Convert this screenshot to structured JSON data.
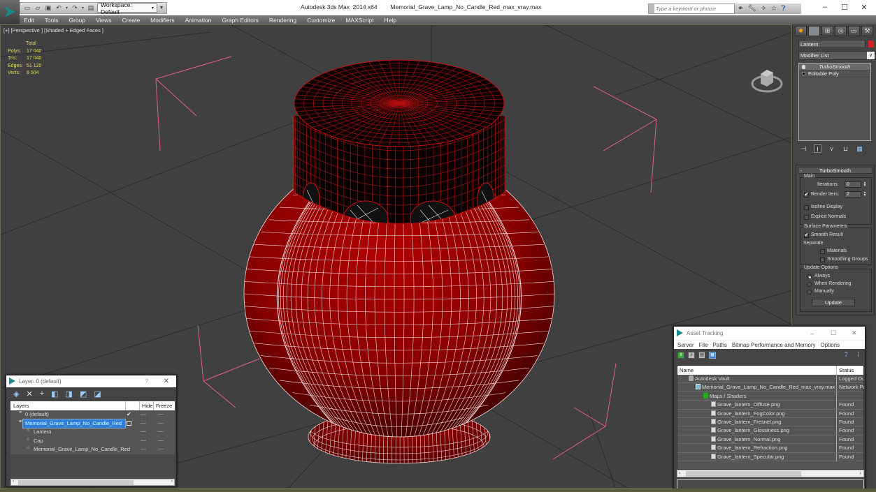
{
  "titlebar": {
    "app_title": "Autodesk 3ds Max  2014 x64",
    "file_name": "Memorial_Grave_Lamp_No_Candle_Red_max_vray.max",
    "workspace_label": "Workspace: Default",
    "search_placeholder": "Type a keyword or phrase",
    "quick_access_icons": [
      "new-file-icon",
      "open-file-icon",
      "save-icon",
      "undo-icon",
      "redo-icon",
      "project-folder-icon"
    ],
    "search_tools_icons": [
      "binoculars-icon",
      "wrench-icon",
      "satellite-icon",
      "star-icon",
      "help-icon"
    ],
    "window_controls": {
      "minimize": "–",
      "maximize": "☐",
      "close": "✕"
    }
  },
  "menubar": [
    "Edit",
    "Tools",
    "Group",
    "Views",
    "Create",
    "Modifiers",
    "Animation",
    "Graph Editors",
    "Rendering",
    "Customize",
    "MAXScript",
    "Help"
  ],
  "viewport": {
    "label": "[+] [Perspective ] [Shaded + Edged Faces ]",
    "stats": {
      "header": "Total",
      "rows": [
        {
          "key": "Polys:",
          "value": "17 040"
        },
        {
          "key": "Tris:",
          "value": "17 040"
        },
        {
          "key": "Edges:",
          "value": "51 120"
        },
        {
          "key": "Verts:",
          "value": "8 504"
        }
      ]
    },
    "model_color": "#8b0000",
    "wire_color": "#ffffff",
    "cap_wire_color": "#c81010"
  },
  "command_panel": {
    "tabs": [
      "create-icon",
      "modify-icon",
      "hierarchy-icon",
      "motion-icon",
      "display-icon",
      "utilities-icon"
    ],
    "object_name": "Lantern",
    "object_color": "#d82020",
    "modifier_list_label": "Modifier List",
    "stack": [
      {
        "label": "TurboSmooth",
        "type": "modifier"
      },
      {
        "label": "Editable Poly",
        "type": "base"
      }
    ],
    "stack_tools": [
      "pin-stack-icon",
      "show-end-result-icon",
      "make-unique-icon",
      "remove-modifier-icon",
      "configure-modifier-sets-icon"
    ],
    "turbosmooth": {
      "title": "TurboSmooth",
      "main_label": "Main",
      "iterations_label": "Iterations:",
      "iterations_value": "0",
      "render_iters_label": "Render Iters:",
      "render_iters_value": "2",
      "render_iters_checked": true,
      "isoline_label": "Isoline Display",
      "isoline_checked": false,
      "explicit_normals_label": "Explicit Normals",
      "explicit_normals_checked": false,
      "surface_label": "Surface Parameters",
      "smooth_result_label": "Smooth Result",
      "smooth_result_checked": true,
      "separate_label": "Separate",
      "materials_label": "Materials",
      "materials_checked": false,
      "smoothing_groups_label": "Smoothing Groups",
      "smoothing_groups_checked": false,
      "update_options_label": "Update Options",
      "always_label": "Always",
      "when_rendering_label": "When Rendering",
      "manually_label": "Manually",
      "update_selected": "Always",
      "update_button": "Update"
    }
  },
  "layer_dialog": {
    "title": "Layer: 0 (default)",
    "help": "?",
    "close": "✕",
    "tools": [
      "new-layer-icon",
      "delete-layer-icon",
      "add-to-layer-icon",
      "select-objects-icon",
      "highlight-layer-icon",
      "hide-all-icon",
      "freeze-all-icon"
    ],
    "columns": [
      "Layers",
      "Hide",
      "Freeze"
    ],
    "rows": [
      {
        "name": "0 (default)",
        "indent": 1,
        "selected": false,
        "active": true
      },
      {
        "name": "Memorial_Grave_Lamp_No_Candle_Red",
        "indent": 1,
        "selected": true,
        "active": false
      },
      {
        "name": "Lantern",
        "indent": 2,
        "selected": false,
        "active": false
      },
      {
        "name": "Cap",
        "indent": 2,
        "selected": false,
        "active": false
      },
      {
        "name": "Memorial_Grave_Lamp_No_Candle_Red",
        "indent": 2,
        "selected": false,
        "active": false
      }
    ]
  },
  "asset_dialog": {
    "title": "Asset Tracking",
    "menu": [
      "Server",
      "File",
      "Paths",
      "Bitmap Performance and Memory",
      "Options"
    ],
    "tools": [
      "vault-icon",
      "list-view-icon",
      "thumbnail-view-icon",
      "table-view-icon"
    ],
    "columns": [
      "Name",
      "Status"
    ],
    "rows": [
      {
        "name": "Autodesk Vault",
        "status": "Logged Ou",
        "indent": 1,
        "icon": "vault"
      },
      {
        "name": "Memorial_Grave_Lamp_No_Candle_Red_max_vray.max",
        "status": "Network Pa",
        "indent": 2,
        "icon": "max"
      },
      {
        "name": "Maps / Shaders",
        "status": "",
        "indent": 3,
        "icon": "maps"
      },
      {
        "name": "Grave_lantern_Diffuse.png",
        "status": "Found",
        "indent": 4,
        "icon": "file"
      },
      {
        "name": "Grave_lantern_FogColor.png",
        "status": "Found",
        "indent": 4,
        "icon": "file"
      },
      {
        "name": "Grave_lantern_Fresnel.png",
        "status": "Found",
        "indent": 4,
        "icon": "file"
      },
      {
        "name": "Grave_lantern_Glossiness.png",
        "status": "Found",
        "indent": 4,
        "icon": "file"
      },
      {
        "name": "Grave_lantern_Normal.png",
        "status": "Found",
        "indent": 4,
        "icon": "file"
      },
      {
        "name": "Grave_lantern_Refraction.png",
        "status": "Found",
        "indent": 4,
        "icon": "file"
      },
      {
        "name": "Grave_lantern_Specular.png",
        "status": "Found",
        "indent": 4,
        "icon": "file"
      }
    ]
  }
}
